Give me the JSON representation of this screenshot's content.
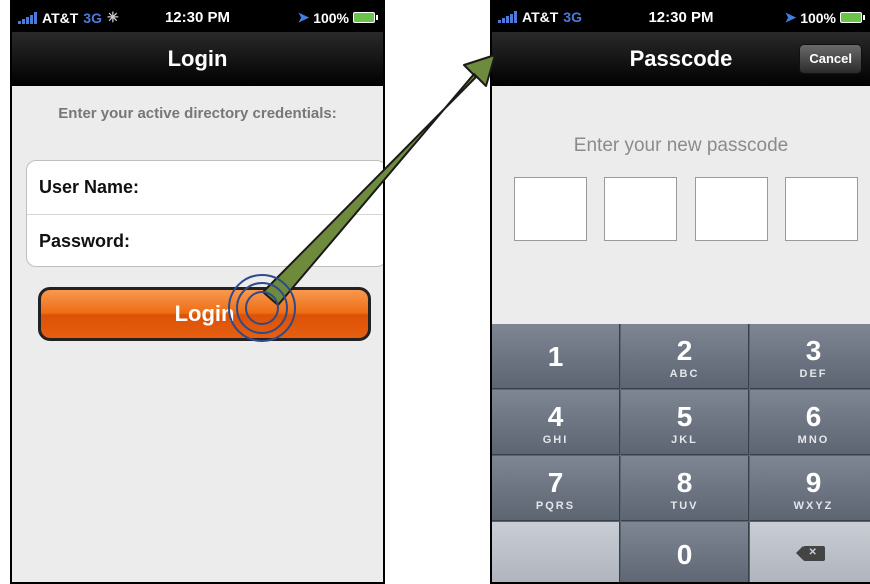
{
  "left_screen": {
    "status": {
      "carrier": "AT&T",
      "network": "3G",
      "time": "12:30 PM",
      "battery": "100%"
    },
    "nav_title": "Login",
    "instruction": "Enter your active directory credentials:",
    "fields": [
      {
        "label": "User Name:",
        "value": ""
      },
      {
        "label": "Password:",
        "value": ""
      }
    ],
    "login_button": "Login"
  },
  "right_screen": {
    "status": {
      "carrier": "AT&T",
      "network": "3G",
      "time": "12:30 PM",
      "battery": "100%"
    },
    "nav_title": "Passcode",
    "cancel_button": "Cancel",
    "prompt": "Enter your new passcode",
    "passcode_digits": [
      "",
      "",
      "",
      ""
    ],
    "keypad": [
      {
        "num": "1",
        "letters": ""
      },
      {
        "num": "2",
        "letters": "ABC"
      },
      {
        "num": "3",
        "letters": "DEF"
      },
      {
        "num": "4",
        "letters": "GHI"
      },
      {
        "num": "5",
        "letters": "JKL"
      },
      {
        "num": "6",
        "letters": "MNO"
      },
      {
        "num": "7",
        "letters": "PQRS"
      },
      {
        "num": "8",
        "letters": "TUV"
      },
      {
        "num": "9",
        "letters": "WXYZ"
      },
      {
        "num": "0",
        "letters": ""
      }
    ]
  },
  "icons": {
    "signal": "signal-bars-icon",
    "activity": "activity-spinner-icon",
    "location": "location-arrow-icon",
    "battery": "battery-icon",
    "delete": "backspace-icon"
  },
  "colors": {
    "login_button": "#ee6d14",
    "transition_arrow": "#6e8b3d",
    "tap_indicator": "#2f4a8a",
    "keypad": "#5b6270"
  }
}
